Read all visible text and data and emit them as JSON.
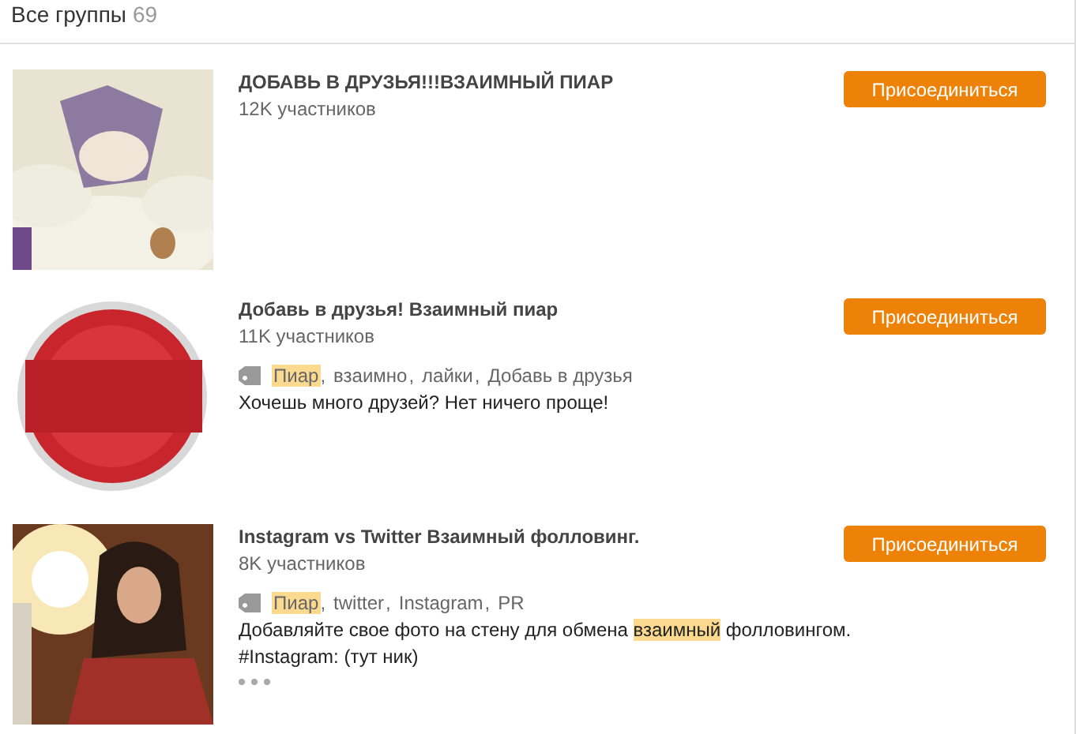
{
  "header": {
    "title": "Все группы",
    "count": "69"
  },
  "groups": [
    {
      "picture": {
        "kind": "picture"
      },
      "name": "ДОБАВЬ В ДРУЗЬЯ!!!ВЗАИМНЫЙ ПИАР",
      "members": "12K участников",
      "join_label": "Присоединиться"
    },
    {
      "picture": {
        "kind": "picture"
      },
      "name": "Добавь в друзья! Взаимный пиар",
      "members": "11K участников",
      "join_label": "Присоединиться",
      "tag_separator": ",",
      "tags": [
        {
          "text": "Пиар",
          "highlighted": true
        },
        {
          "text": "взаимно",
          "highlighted": false
        },
        {
          "text": "лайки",
          "highlighted": false
        },
        {
          "text": "Добавь в друзья",
          "highlighted": false
        }
      ],
      "description": [
        [
          {
            "text": "Хочешь много друзей? Нет ничего проще!",
            "highlighted": false
          }
        ]
      ]
    },
    {
      "picture": {
        "kind": "picture"
      },
      "name": "Instagram vs Twitter Взаимный фолловинг.",
      "members": "8K участников",
      "join_label": "Присоединиться",
      "tag_separator": ",",
      "tags": [
        {
          "text": "Пиар",
          "highlighted": true
        },
        {
          "text": "twitter",
          "highlighted": false
        },
        {
          "text": "Instagram",
          "highlighted": false
        },
        {
          "text": "PR",
          "highlighted": false
        }
      ],
      "description": [
        [
          {
            "text": "Добавляйте свое фото на стену для обмена ",
            "highlighted": false
          },
          {
            "text": "взаимный",
            "highlighted": true
          },
          {
            "text": " фолловингом.",
            "highlighted": false
          }
        ],
        [
          {
            "text": "#Instagram: (тут ник)",
            "highlighted": false
          }
        ]
      ],
      "has_more": true
    }
  ]
}
